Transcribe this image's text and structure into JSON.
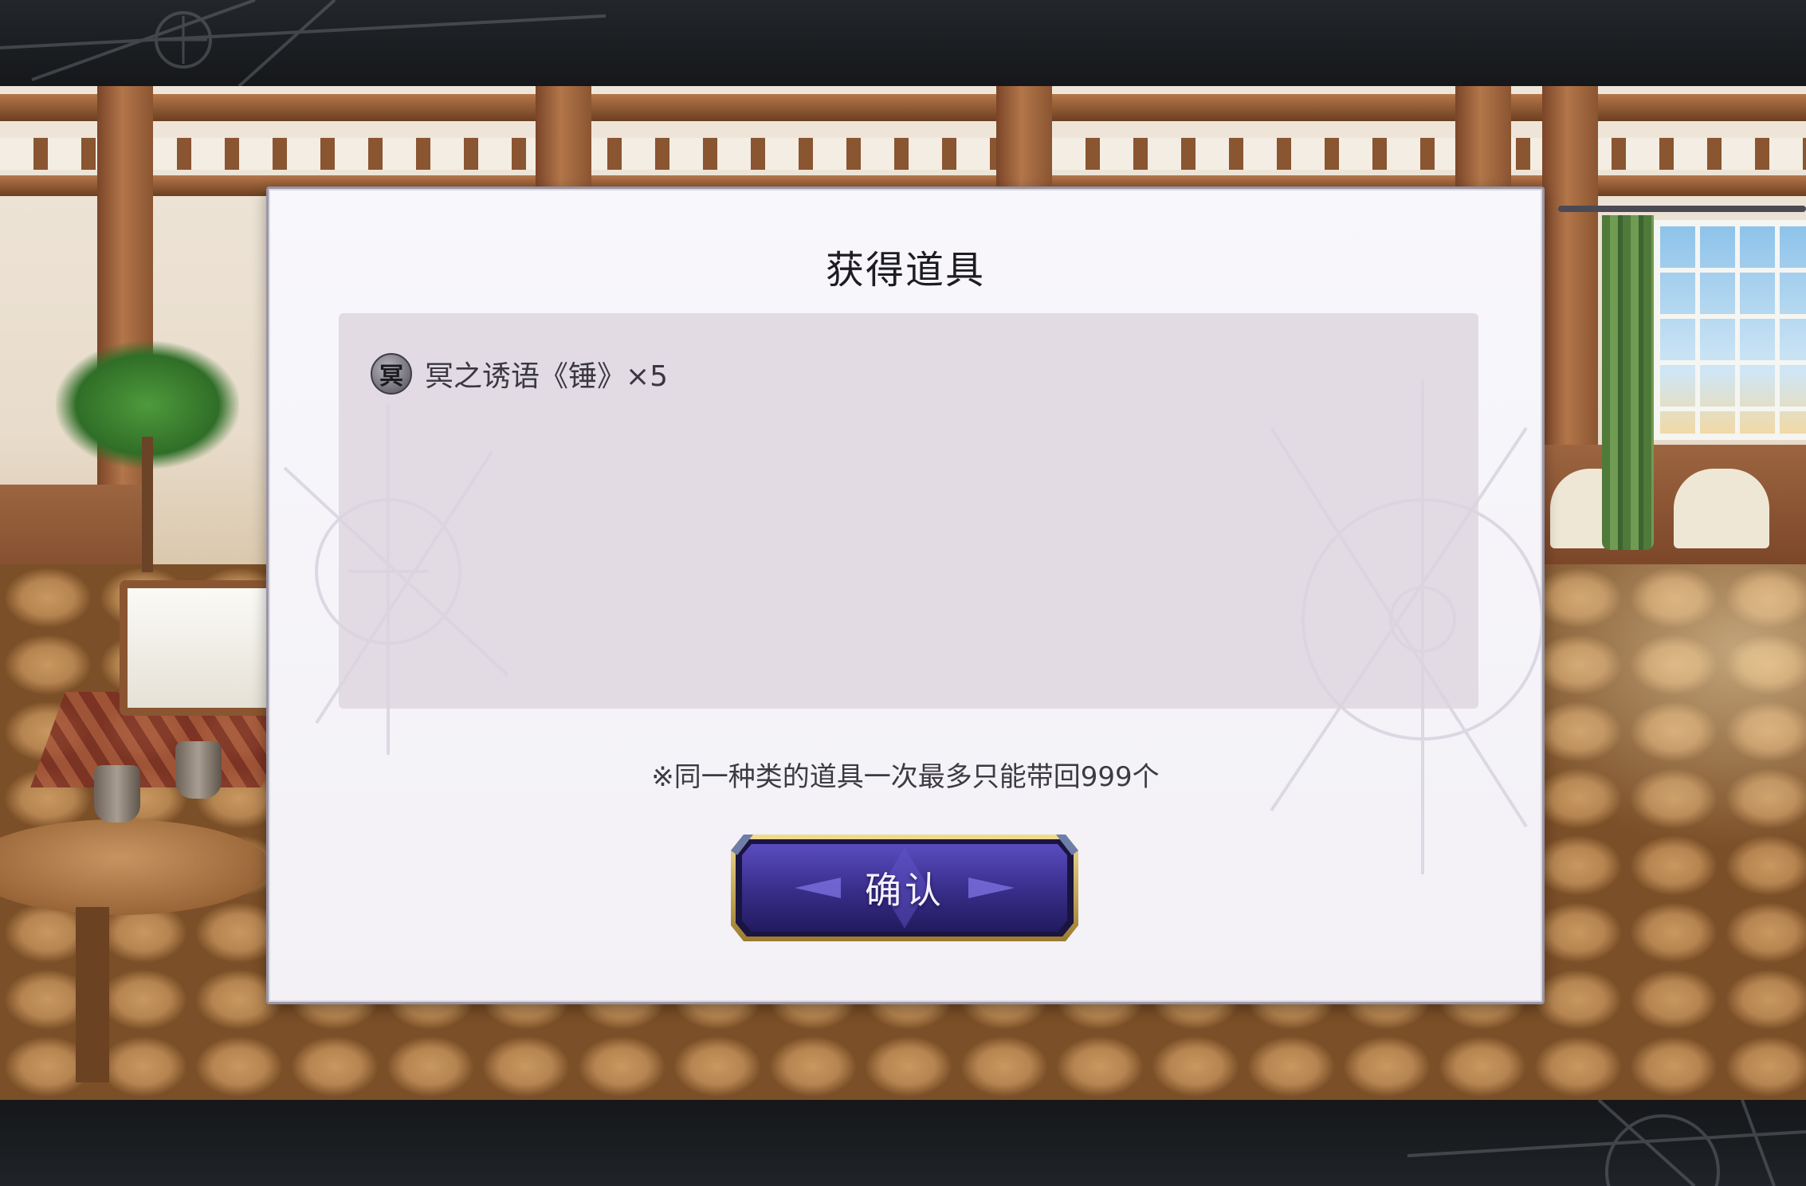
{
  "dialog": {
    "title": "获得道具",
    "items": [
      {
        "icon_char": "冥",
        "label": "冥之诱语《锤》×5"
      }
    ],
    "notice": "※同一种类的道具一次最多只能带回999个",
    "confirm_label": "确认"
  },
  "colors": {
    "dialog_bg": "#f6f5f9",
    "item_box_bg": "#e3dbe3",
    "button_purple": "#3a2f8c",
    "button_gold": "#c9a94e",
    "frame_dark": "#15171a"
  }
}
